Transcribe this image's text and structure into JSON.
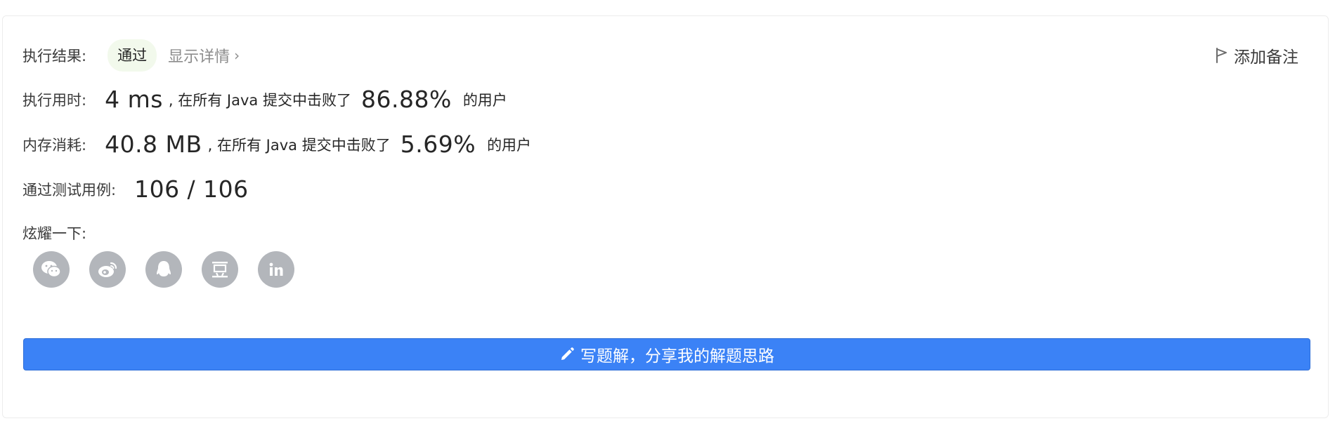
{
  "result": {
    "label": "执行结果:",
    "status": "通过",
    "detail_link": "显示详情",
    "detail_chevron": "›"
  },
  "add_note": {
    "label": "添加备注",
    "icon": "flag-icon"
  },
  "runtime": {
    "label": "执行用时:",
    "value": "4 ms",
    "mid_text": ", 在所有 Java 提交中击败了",
    "percent": "86.88%",
    "suffix": "的用户"
  },
  "memory": {
    "label": "内存消耗:",
    "value": "40.8 MB",
    "mid_text": ", 在所有 Java 提交中击败了",
    "percent": "5.69%",
    "suffix": "的用户"
  },
  "testcases": {
    "label": "通过测试用例:",
    "value": "106 / 106"
  },
  "share": {
    "label": "炫耀一下:",
    "buttons": [
      {
        "icon": "wechat-icon"
      },
      {
        "icon": "weibo-icon"
      },
      {
        "icon": "qq-icon"
      },
      {
        "icon": "douban-icon"
      },
      {
        "icon": "linkedin-icon"
      }
    ]
  },
  "write_solution": {
    "label": "写题解，分享我的解题思路",
    "icon": "pencil-icon"
  },
  "colors": {
    "accent": "#3b82f6",
    "pass_bg": "#f2f9ec",
    "share_icon_bg": "#b3b6bb"
  }
}
